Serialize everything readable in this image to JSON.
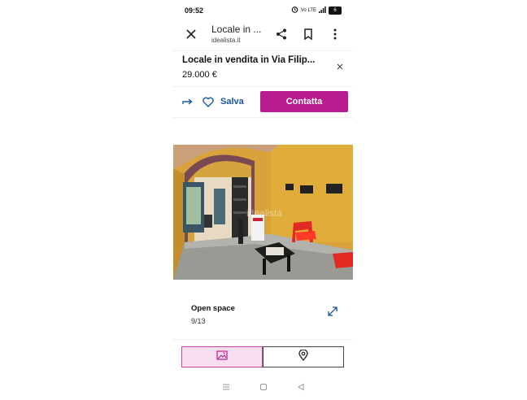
{
  "status_bar": {
    "time": "09:52",
    "signal_text": "Vo LTE",
    "battery_level": "6"
  },
  "toolbar": {
    "title": "Locale in ...",
    "subtitle": "idealista.it"
  },
  "listing": {
    "title": "Locale in vendita in Via Filip...",
    "price": "29.000 €"
  },
  "actions": {
    "save_label": "Salva",
    "contact_label": "Contatta"
  },
  "photo": {
    "watermark": "idealista"
  },
  "caption": {
    "title": "Open space",
    "count": "9/13"
  },
  "colors": {
    "accent": "#b71d8f",
    "link": "#1a55a8",
    "tab_active_bg": "#f7dff0"
  },
  "icons": [
    "close-icon",
    "share-icon",
    "bookmark-icon",
    "more-icon",
    "close-icon",
    "forward-icon",
    "heart-icon",
    "expand-icon",
    "image-icon",
    "location-pin-icon"
  ]
}
